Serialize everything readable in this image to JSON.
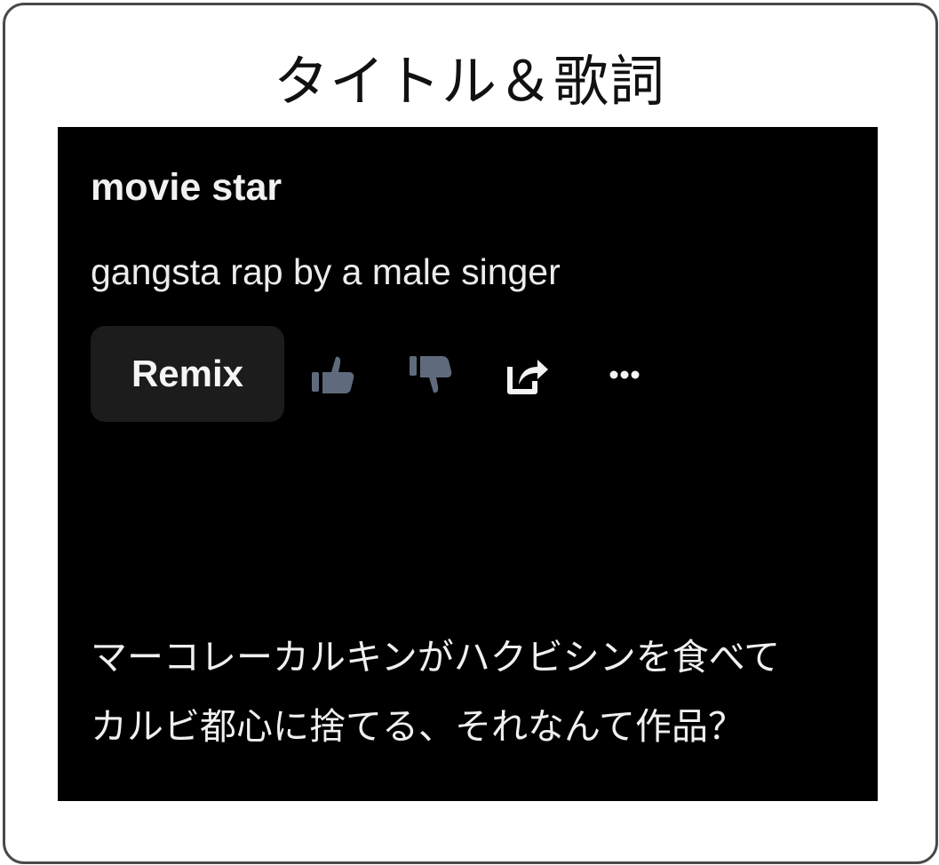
{
  "header": {
    "title": "タイトル＆歌詞"
  },
  "song": {
    "title": "movie star",
    "style": "gangsta rap by a male singer"
  },
  "actions": {
    "remix_label": "Remix",
    "icons": [
      "thumbs-up-icon",
      "thumbs-down-icon",
      "share-icon",
      "more-icon"
    ]
  },
  "lyrics": {
    "line1": "マーコレーカルキンがハクビシンを食べて",
    "line2": "カルビ都心に捨てる、それなんて作品？"
  },
  "colors": {
    "frame_border": "#4a4a4a",
    "panel_background": "#000000",
    "button_background": "#1c1c1c",
    "icon_muted": "#5f6b7d",
    "icon_light": "#f3f3f3"
  }
}
